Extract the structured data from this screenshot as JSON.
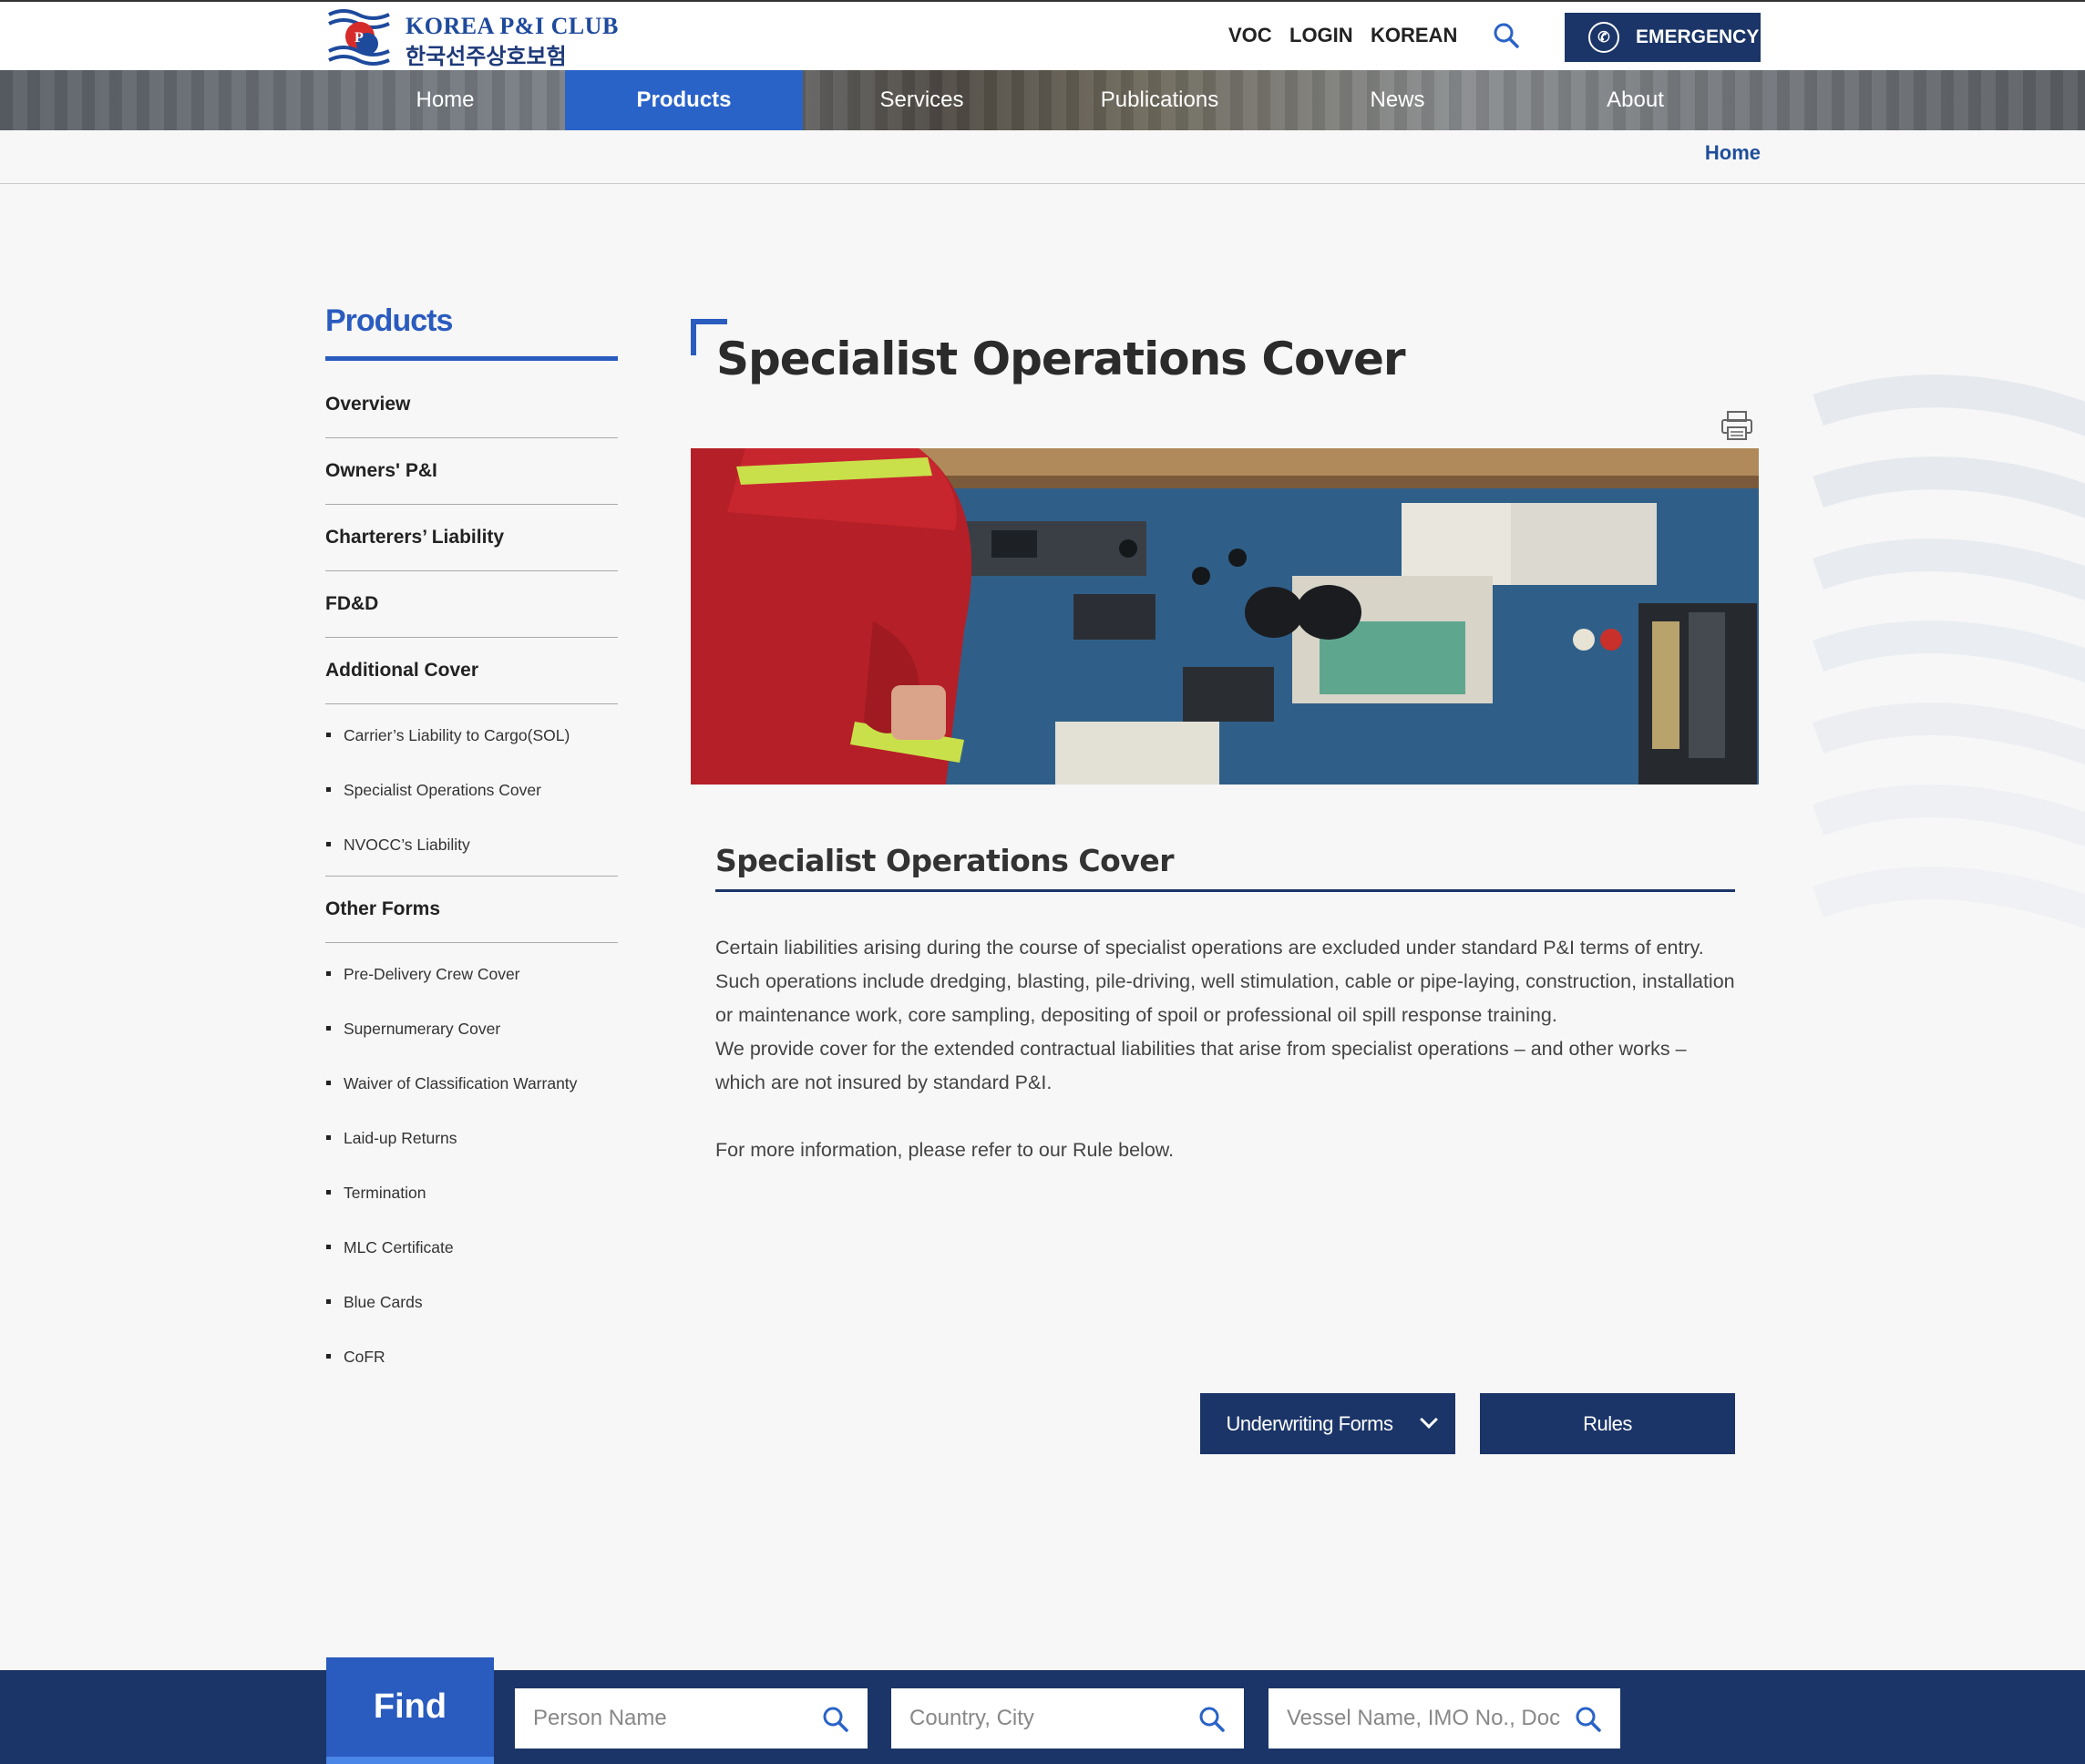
{
  "header": {
    "logo_en": "KOREA P&I CLUB",
    "logo_ko": "한국선주상호보험",
    "utility_links": [
      "VOC",
      "LOGIN",
      "KOREAN"
    ],
    "emergency_label": "EMERGENCY"
  },
  "nav": {
    "items": [
      "Home",
      "Products",
      "Services",
      "Publications",
      "News",
      "About"
    ],
    "active": "Products"
  },
  "breadcrumb": "Home",
  "sidebar": {
    "title": "Products",
    "overview": "Overview",
    "owners": "Owners' P&I",
    "charterers": "Charterers’ Liability",
    "fdd": "FD&D",
    "additional": "Additional Cover",
    "additional_items": [
      "Carrier’s Liability to Cargo(SOL)",
      "Specialist Operations Cover",
      "NVOCC’s Liability"
    ],
    "other": "Other Forms",
    "other_items": [
      "Pre-Delivery Crew Cover",
      "Supernumerary Cover",
      "Waiver of Classification Warranty",
      "Laid-up Returns",
      "Termination",
      "MLC Certificate",
      "Blue Cards",
      "CoFR"
    ]
  },
  "content": {
    "page_title": "Specialist Operations Cover",
    "section_title": "Specialist Operations Cover",
    "paragraph1": "Certain liabilities arising during the course of specialist operations are excluded under standard P&I terms of entry. Such operations include dredging, blasting, pile-driving, well stimulation, cable or pipe-laying, construction, installation or maintenance work, core sampling, depositing of spoil or professional oil spill response training.",
    "paragraph2": "We provide cover for the extended contractual liabilities that arise from specialist operations – and other works – which are not insured by standard P&I.",
    "paragraph3": "For more information, please refer to our Rule below.",
    "btn_forms": "Underwriting Forms",
    "btn_rules": "Rules"
  },
  "find": {
    "label": "Find",
    "person_placeholder": "Person Name",
    "city_placeholder": "Country, City",
    "vessel_placeholder": "Vessel Name, IMO No., Doc No"
  },
  "colors": {
    "navy": "#1b3568",
    "accent_blue": "#2a5bbf"
  }
}
